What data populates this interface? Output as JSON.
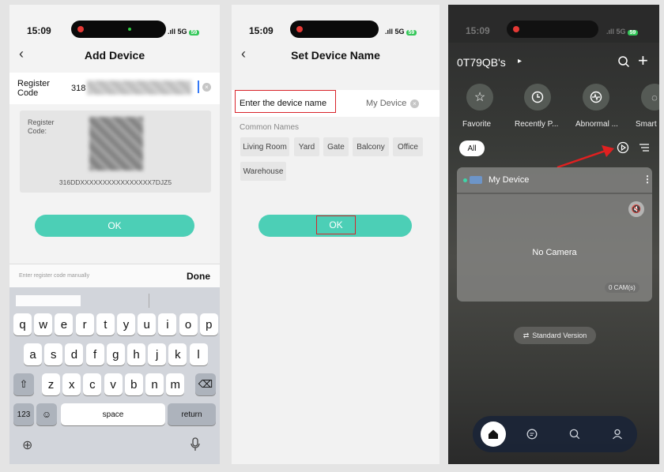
{
  "p1": {
    "time": "15:09",
    "signal": "5G",
    "battery": "59",
    "title": "Add Device",
    "register_label": "Register Code",
    "register_value": "318",
    "card_label": "Register Code:",
    "card_code": "316DDXXXXXXXXXXXXXXXX7DJZ5",
    "ok": "OK",
    "hint": "Enter register code manually",
    "done": "Done",
    "kb_row1": [
      "q",
      "w",
      "e",
      "r",
      "t",
      "y",
      "u",
      "i",
      "o",
      "p"
    ],
    "kb_row2": [
      "a",
      "s",
      "d",
      "f",
      "g",
      "h",
      "j",
      "k",
      "l"
    ],
    "kb_row3": [
      "z",
      "x",
      "c",
      "v",
      "b",
      "n",
      "m"
    ],
    "kb_123": "123",
    "kb_space": "space",
    "kb_return": "return"
  },
  "p2": {
    "time": "15:09",
    "signal": "5G",
    "battery": "59",
    "title": "Set Device Name",
    "name_placeholder": "Enter the device name",
    "name_value": "My Device",
    "common_label": "Common Names",
    "chips": [
      "Living Room",
      "Yard",
      "Gate",
      "Balcony",
      "Office",
      "Warehouse"
    ],
    "ok": "OK"
  },
  "p3": {
    "time": "15:09",
    "signal": "5G",
    "battery": "59",
    "account": "0T79QB's",
    "quick": [
      "Favorite",
      "Recently P...",
      "Abnormal ...",
      "Smart"
    ],
    "filter_all": "All",
    "device_name": "My Device",
    "no_camera": "No Camera",
    "cam_count": "0 CAM(s)",
    "version": "Standard Version"
  },
  "colors": {
    "accent": "#4ccfb6",
    "highlight": "#d8232a",
    "battery": "#34c759"
  }
}
